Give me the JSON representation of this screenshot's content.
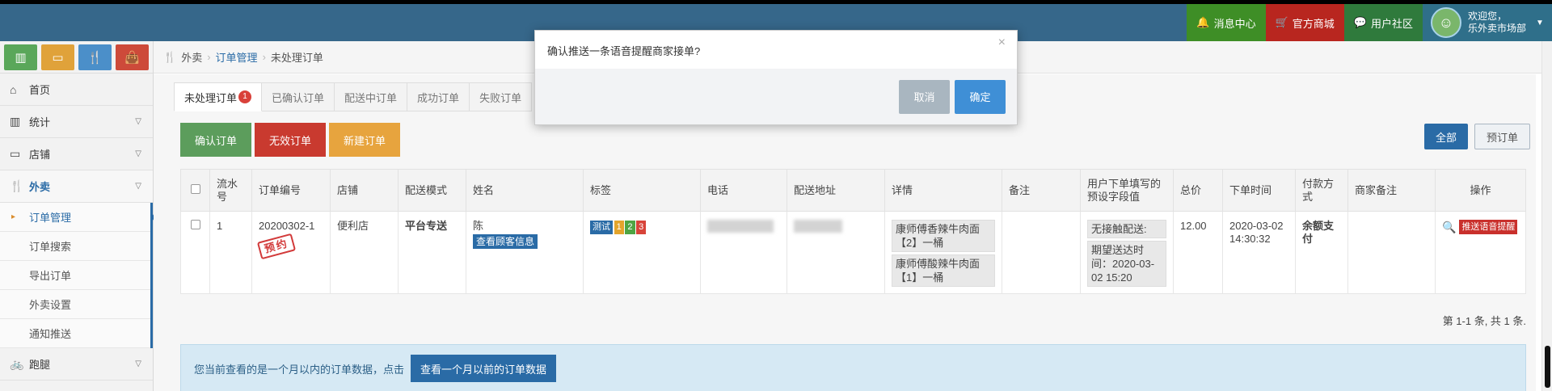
{
  "header": {
    "nav": {
      "messages": "消息中心",
      "mall": "官方商城",
      "community": "用户社区"
    },
    "user": {
      "welcome": "欢迎您，",
      "name": "乐外卖市场部"
    }
  },
  "sidebar": {
    "menu": {
      "home": "首页",
      "stats": "统计",
      "shop": "店铺",
      "takeout": "外卖",
      "errand": "跑腿"
    },
    "submenu": {
      "order_manage": "订单管理",
      "order_search": "订单搜索",
      "export_order": "导出订单",
      "takeout_settings": "外卖设置",
      "notify_push": "通知推送"
    }
  },
  "breadcrumb": {
    "root": "外卖",
    "level1": "订单管理",
    "level2": "未处理订单"
  },
  "tabs": {
    "unprocessed": "未处理订单",
    "unprocessed_count": "1",
    "confirmed": "已确认订单",
    "delivering": "配送中订单",
    "success": "成功订单",
    "failed": "失败订单"
  },
  "actions": {
    "confirm": "确认订单",
    "invalid": "无效订单",
    "new_order": "新建订单",
    "all": "全部",
    "preorder": "预订单"
  },
  "table": {
    "headers": {
      "serial": "流水号",
      "order_no": "订单编号",
      "shop": "店铺",
      "delivery_mode": "配送模式",
      "name": "姓名",
      "tags": "标签",
      "phone": "电话",
      "address": "配送地址",
      "detail": "详情",
      "remark": "备注",
      "preset_field": "用户下单填写的预设字段值",
      "total": "总价",
      "order_time": "下单时间",
      "pay_method": "付款方式",
      "merchant_remark": "商家备注",
      "operation": "操作"
    },
    "rows": [
      {
        "serial": "1",
        "order_no": "20200302-1",
        "stamp": "预约",
        "shop": "便利店",
        "delivery_mode": "平台专送",
        "name": "陈",
        "view_customer": "查看顾客信息",
        "tags": {
          "test": "测试",
          "t1": "1",
          "t2": "2",
          "t3": "3"
        },
        "detail_1": "康师傅香辣牛肉面【2】一桶",
        "detail_2": "康师傅酸辣牛肉面【1】一桶",
        "preset_1": "无接触配送:",
        "preset_2": "期望送达时间：2020-03-02 15:20",
        "total": "12.00",
        "order_time": "2020-03-02 14:30:32",
        "pay_method": "余额支付",
        "merchant_remark": "",
        "remind": "推送语音提醒"
      }
    ]
  },
  "pager": "第 1-1 条, 共 1 条.",
  "info": {
    "text": "您当前查看的是一个月以内的订单数据，点击",
    "button": "查看一个月以前的订单数据"
  },
  "modal": {
    "message": "确认推送一条语音提醒商家接单?",
    "close": "×",
    "cancel": "取消",
    "ok": "确定"
  }
}
